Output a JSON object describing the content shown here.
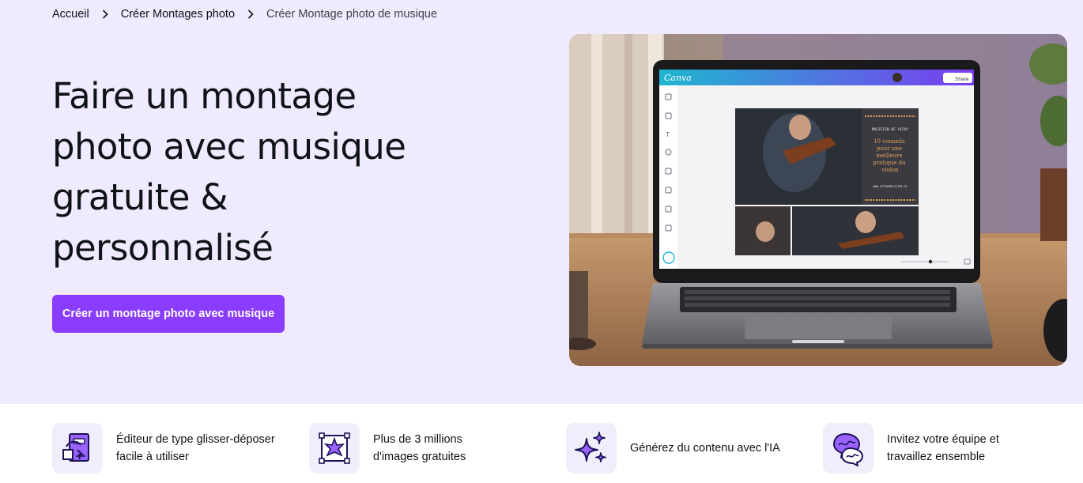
{
  "breadcrumb": {
    "items": [
      {
        "label": "Accueil"
      },
      {
        "label": "Créer Montages photo"
      },
      {
        "label": "Créer Montage photo de musique"
      }
    ]
  },
  "hero": {
    "title_lines": [
      "Faire un montage",
      "photo avec musique",
      "gratuite &",
      "personnalisé"
    ],
    "cta_label": "Créer un montage photo avec musique"
  },
  "mockup": {
    "brand": "Canva",
    "share_label": "Share",
    "poster": {
      "kicker": "MUSICIEN DE VICHY",
      "headline_lines": [
        "10 conseils",
        "pour une",
        "meilleure",
        "pratique du",
        "violon"
      ],
      "website": "WWW.SITEDUMUSICIEN.FR"
    }
  },
  "features": [
    {
      "icon": "drag-drop-editor-icon",
      "lines": [
        "Éditeur de type glisser-déposer",
        "facile à utiliser"
      ]
    },
    {
      "icon": "image-library-icon",
      "lines": [
        "Plus de 3 millions",
        "d'images gratuites"
      ]
    },
    {
      "icon": "ai-sparkles-icon",
      "lines": [
        "Générez du contenu avec l'IA"
      ]
    },
    {
      "icon": "team-chat-icon",
      "lines": [
        "Invitez votre équipe et",
        "travaillez ensemble"
      ]
    }
  ],
  "colors": {
    "hero_bg": "#efeafd",
    "accent": "#8b3dff",
    "icon_tile_bg": "#f1eefc",
    "text": "#0e1318"
  }
}
